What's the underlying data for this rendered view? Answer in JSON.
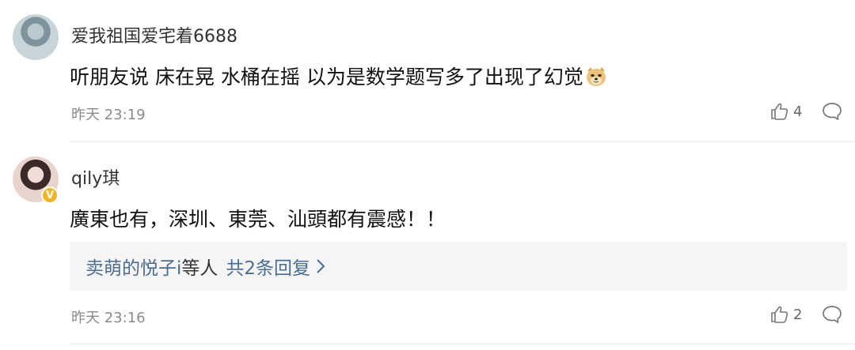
{
  "comments": [
    {
      "username": "爱我祖国爱宅着6688",
      "text": "听朋友说 床在晃 水桶在摇 以为是数学题写多了出现了幻觉",
      "time": "昨天 23:19",
      "likes": "4"
    },
    {
      "username": "qily琪",
      "text": "廣東也有，深圳、東莞、汕頭都有震感！！",
      "reply_summary": "卖萌的悦子i等人 共2条回复",
      "reply_names": "卖萌的悦子i",
      "reply_suffix": "等人",
      "reply_count": "共2条回复",
      "time": "昨天 23:16",
      "likes": "2",
      "verified": "V"
    }
  ],
  "icons": {
    "like": "thumbs-up-icon",
    "comment": "comment-bubble-icon",
    "emoji": "doge-emoji-icon"
  }
}
